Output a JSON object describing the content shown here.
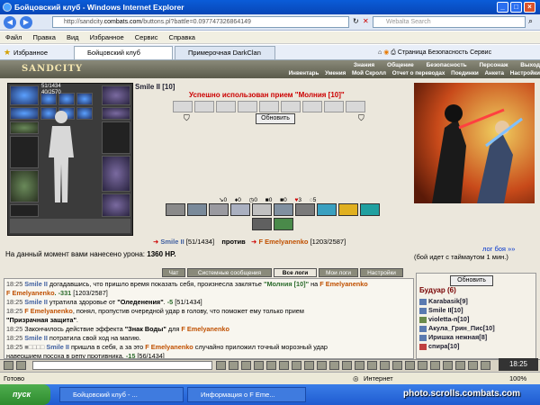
{
  "window": {
    "title": "Бойцовский клуб - Windows Internet Explorer",
    "min": "_",
    "max": "□",
    "close": "×"
  },
  "address": {
    "url_prefix": "http://sandcity.",
    "url_domain": "combats.com",
    "url_rest": "/buttons.pl?battle=0.097747326864149",
    "search_placeholder": "Webalta Search"
  },
  "menu": [
    "Файл",
    "Правка",
    "Вид",
    "Избранное",
    "Сервис",
    "Справка"
  ],
  "tabs": {
    "favorites": "Избранное",
    "tab1": "Бойцовский клуб",
    "tab2": "Примерочная DarkClan"
  },
  "ietools": {
    "page": "Страница",
    "security": "Безопасность",
    "service": "Сервис"
  },
  "game": {
    "logo": "SANDCITY",
    "nav_top": [
      "Знания",
      "Общение",
      "Безопасность",
      "Персонаж",
      "Выход"
    ],
    "nav_bottom": [
      "Инвентарь",
      "Умения",
      "Мой Скролл",
      "Отчет о переводах",
      "Поединки",
      "Анкета",
      "Настройки"
    ]
  },
  "battle": {
    "hp_display": "51/1434",
    "mana_display": "40/2570",
    "char_name": "Smile II [10]",
    "success_msg": "Успешно использован прием \"Молния [10]\"",
    "refresh": "Обновить",
    "stats": [
      "0",
      "0",
      "0",
      "0",
      "0",
      "3",
      "5"
    ],
    "player": "Smile II",
    "player_hp": "[51/1434]",
    "vs": "против",
    "enemy": "F Emelyanenko",
    "enemy_hp": "[1203/2587]",
    "damage_label": "На данный момент вами нанесено урона:",
    "damage_value": "1360 HP.",
    "log_link": "лог боя »»",
    "timeout": "(бой идет с таймаутом 1 мин.)"
  },
  "logtabs": [
    "Чат",
    "Системные сообщения",
    "Все логи",
    "Мои логи",
    "Настройки"
  ],
  "chat": [
    {
      "time": "18:25",
      "a": "Smile II",
      "text": " догадавшись, что пришло время показать себя, произнесла заклятье ",
      "spell": "\"Молния [10]\"",
      "text2": " на ",
      "b": "F Emelyanenko",
      "dmg": ". -331",
      "hp": " [1203/2587]"
    },
    {
      "time": "18:25",
      "a": "Smile II",
      "text": " утратила здоровье от ",
      "spell": "\"Оледенения\"",
      "text2": ". ",
      "b": "",
      "dmg": "-5",
      "hp": " [51/1434]"
    },
    {
      "time": "18:25",
      "a": "F Emelyanenko",
      "text": ", понял, пропустив очередной удар в голову, что поможет ему только прием ",
      "spell": "\"Призрачная защита\"",
      "text2": ".",
      "b": "",
      "dmg": "",
      "hp": ""
    },
    {
      "time": "18:25",
      "a": "",
      "text": "Закончилось действие эффекта ",
      "spell": "\"Знак Воды\"",
      "text2": " для ",
      "b": "F Emelyanenko",
      "dmg": "",
      "hp": ""
    },
    {
      "time": "18:25",
      "a": "Smile II",
      "text": " потратила свой ход на магию.",
      "spell": "",
      "text2": "",
      "b": "",
      "dmg": "",
      "hp": ""
    },
    {
      "time": "18:25",
      "a": "Smile II",
      "text": " пришла в себя, а за это ",
      "spell": "",
      "text2": "",
      "b": "F Emelyanenko",
      "dmg": "",
      "hp": " случайно приложил точный морозный удар"
    },
    {
      "time": "",
      "a": "",
      "text": "навершием посоха в репу противника. ",
      "spell": "",
      "text2": "",
      "b": "",
      "dmg": "-15",
      "hp": " [56/1434]"
    }
  ],
  "budoir": {
    "title": "Будуар (6)",
    "refresh": "Обновить",
    "members": [
      "Karabasik[9]",
      "Smile II[10]",
      "violetta-n[10]",
      "Акула_Грин_Пис[10]",
      "Иришка нежная[8]",
      "спира[10]"
    ]
  },
  "clock": "18:25",
  "status": {
    "ready": "Готово",
    "zone": "Интернет",
    "zoom": "100%"
  },
  "taskbar": {
    "start": "пуск",
    "t1": "Бойцовский клуб - ...",
    "t2": "Информация о F Eme...",
    "watermark": "photo.scrolls.combats.com"
  },
  "colors": {
    "titlebar": "#0a5cd8",
    "enemy": "#c05000",
    "player": "#4060a0",
    "success": "#c00000"
  }
}
